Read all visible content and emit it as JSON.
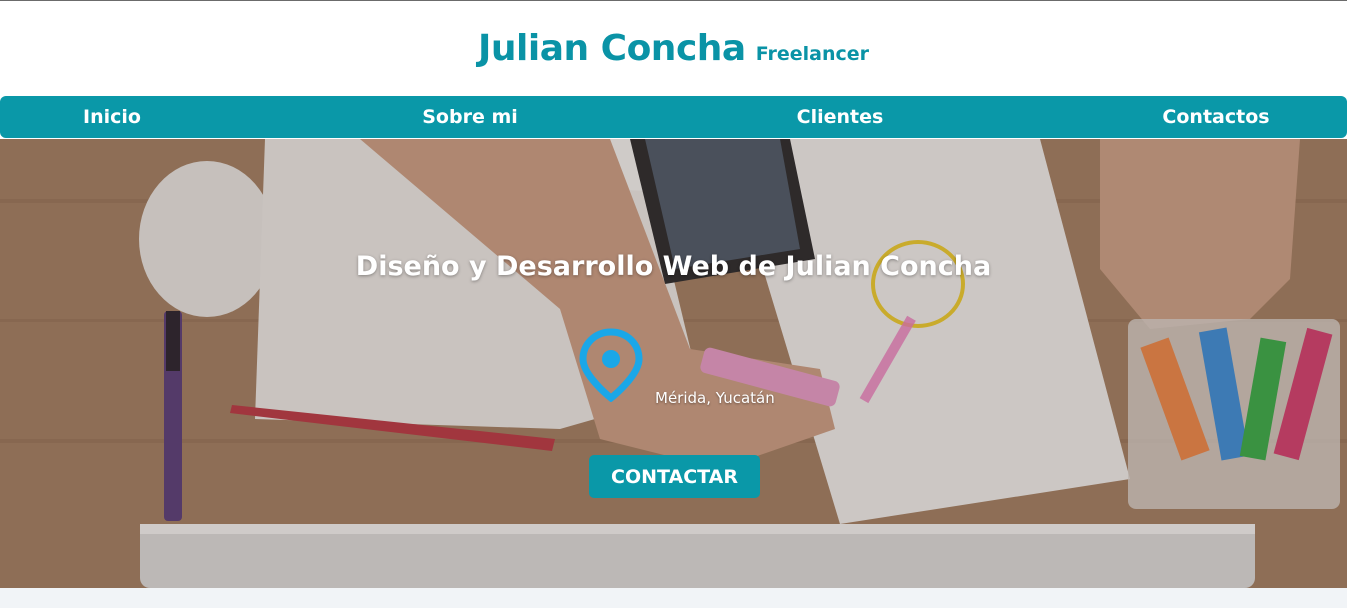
{
  "header": {
    "name": "Julian Concha",
    "tagline": "Freelancer"
  },
  "nav": {
    "items": [
      {
        "label": "Inicio"
      },
      {
        "label": "Sobre mi"
      },
      {
        "label": "Clientes"
      },
      {
        "label": "Contactos"
      }
    ]
  },
  "hero": {
    "title": "Diseño y Desarrollo Web de Julian Concha",
    "location": "Mérida, Yucatán",
    "cta_label": "CONTACTAR"
  },
  "colors": {
    "accent": "#0a98a8",
    "brand_text": "#0a93a6",
    "pin_icon": "#1aa7e8"
  }
}
